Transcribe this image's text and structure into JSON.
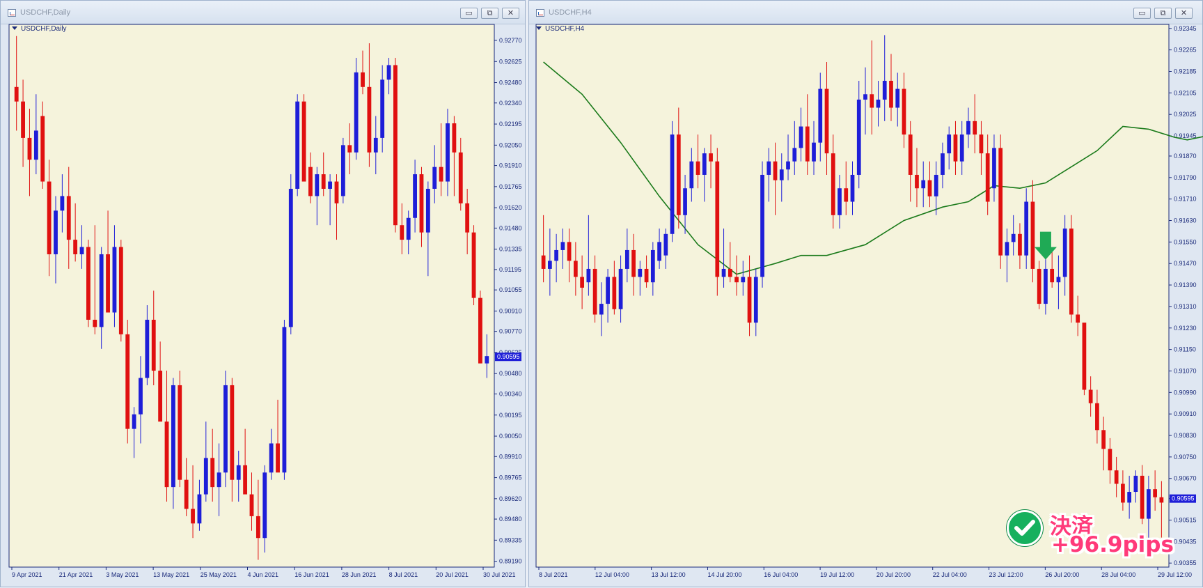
{
  "windows": [
    {
      "title": "USDCHF,Daily",
      "chart_label": "USDCHF,Daily"
    },
    {
      "title": "USDCHF,H4",
      "chart_label": "USDCHF,H4"
    }
  ],
  "window_buttons": {
    "minimize": "▭",
    "restore": "⧉",
    "close": "✕"
  },
  "colors": {
    "bg": "#f5f3dc",
    "bull": "#1e1ed8",
    "bear": "#e01010",
    "ma": "#1a7a1a",
    "axis": "#1a2a7a",
    "arrow": "#1faa55",
    "badge": "#16b05e",
    "settle_text": "#ff3a7a"
  },
  "annotation": {
    "line1": "決済",
    "line2": "+96.9pips"
  },
  "chart_data": [
    {
      "type": "candlestick",
      "symbol": "USDCHF",
      "timeframe": "Daily",
      "ylim": [
        0.8915,
        0.9288
      ],
      "yticks": [
        0.9277,
        0.92625,
        0.9248,
        0.9234,
        0.92195,
        0.9205,
        0.9191,
        0.91765,
        0.9162,
        0.9148,
        0.91335,
        0.91195,
        0.91055,
        0.9091,
        0.9077,
        0.90625,
        0.9048,
        0.9034,
        0.90195,
        0.9005,
        0.8991,
        0.89765,
        0.8962,
        0.8948,
        0.89335,
        0.8919
      ],
      "xticks": [
        "9 Apr 2021",
        "21 Apr 2021",
        "3 May 2021",
        "13 May 2021",
        "25 May 2021",
        "4 Jun 2021",
        "16 Jun 2021",
        "28 Jun 2021",
        "8 Jul 2021",
        "20 Jul 2021",
        "30 Jul 2021"
      ],
      "current_price": "0.90595",
      "ohlc": [
        [
          0.9245,
          0.928,
          0.9215,
          0.9235
        ],
        [
          0.9235,
          0.925,
          0.919,
          0.921
        ],
        [
          0.921,
          0.923,
          0.917,
          0.9195
        ],
        [
          0.9195,
          0.924,
          0.9185,
          0.9215
        ],
        [
          0.9225,
          0.9235,
          0.9175,
          0.918
        ],
        [
          0.918,
          0.9195,
          0.9115,
          0.913
        ],
        [
          0.913,
          0.917,
          0.911,
          0.916
        ],
        [
          0.916,
          0.9185,
          0.9145,
          0.917
        ],
        [
          0.917,
          0.919,
          0.912,
          0.914
        ],
        [
          0.914,
          0.9165,
          0.9125,
          0.913
        ],
        [
          0.913,
          0.915,
          0.912,
          0.9135
        ],
        [
          0.9135,
          0.914,
          0.908,
          0.9085
        ],
        [
          0.9085,
          0.915,
          0.9075,
          0.908
        ],
        [
          0.908,
          0.9135,
          0.9065,
          0.913
        ],
        [
          0.913,
          0.916,
          0.91,
          0.909
        ],
        [
          0.909,
          0.915,
          0.908,
          0.9135
        ],
        [
          0.9135,
          0.914,
          0.907,
          0.9075
        ],
        [
          0.9075,
          0.9085,
          0.9,
          0.901
        ],
        [
          0.901,
          0.9025,
          0.899,
          0.902
        ],
        [
          0.902,
          0.906,
          0.9,
          0.9045
        ],
        [
          0.9045,
          0.9095,
          0.904,
          0.9085
        ],
        [
          0.9085,
          0.9105,
          0.904,
          0.905
        ],
        [
          0.905,
          0.907,
          0.903,
          0.9015
        ],
        [
          0.9015,
          0.905,
          0.896,
          0.897
        ],
        [
          0.897,
          0.9045,
          0.8955,
          0.904
        ],
        [
          0.904,
          0.905,
          0.897,
          0.8975
        ],
        [
          0.8975,
          0.899,
          0.895,
          0.8955
        ],
        [
          0.8955,
          0.8985,
          0.8935,
          0.8945
        ],
        [
          0.8945,
          0.8975,
          0.894,
          0.8965
        ],
        [
          0.8965,
          0.9015,
          0.896,
          0.899
        ],
        [
          0.899,
          0.901,
          0.896,
          0.897
        ],
        [
          0.897,
          0.9,
          0.895,
          0.898
        ],
        [
          0.898,
          0.905,
          0.897,
          0.904
        ],
        [
          0.904,
          0.9045,
          0.896,
          0.8975
        ],
        [
          0.8975,
          0.8995,
          0.896,
          0.8985
        ],
        [
          0.8985,
          0.901,
          0.897,
          0.8965
        ],
        [
          0.8965,
          0.898,
          0.894,
          0.895
        ],
        [
          0.895,
          0.8975,
          0.892,
          0.8935
        ],
        [
          0.8935,
          0.8985,
          0.8925,
          0.898
        ],
        [
          0.898,
          0.901,
          0.8975,
          0.9
        ],
        [
          0.9,
          0.903,
          0.8985,
          0.898
        ],
        [
          0.898,
          0.9085,
          0.8975,
          0.908
        ],
        [
          0.908,
          0.9185,
          0.9075,
          0.9175
        ],
        [
          0.9175,
          0.924,
          0.917,
          0.9235
        ],
        [
          0.9235,
          0.924,
          0.9185,
          0.918
        ],
        [
          0.919,
          0.92,
          0.9165,
          0.917
        ],
        [
          0.917,
          0.919,
          0.915,
          0.9185
        ],
        [
          0.9185,
          0.92,
          0.917,
          0.9175
        ],
        [
          0.9175,
          0.9185,
          0.915,
          0.918
        ],
        [
          0.918,
          0.9185,
          0.914,
          0.9165
        ],
        [
          0.917,
          0.921,
          0.9165,
          0.9205
        ],
        [
          0.9205,
          0.922,
          0.9185,
          0.92
        ],
        [
          0.92,
          0.9265,
          0.9195,
          0.9255
        ],
        [
          0.9255,
          0.927,
          0.924,
          0.9245
        ],
        [
          0.9245,
          0.9275,
          0.919,
          0.92
        ],
        [
          0.92,
          0.9225,
          0.9185,
          0.921
        ],
        [
          0.921,
          0.926,
          0.92,
          0.925
        ],
        [
          0.925,
          0.9265,
          0.924,
          0.926
        ],
        [
          0.926,
          0.9265,
          0.9145,
          0.915
        ],
        [
          0.915,
          0.9165,
          0.913,
          0.914
        ],
        [
          0.914,
          0.916,
          0.913,
          0.9155
        ],
        [
          0.9155,
          0.9195,
          0.9145,
          0.9185
        ],
        [
          0.9185,
          0.919,
          0.9135,
          0.9145
        ],
        [
          0.9145,
          0.918,
          0.9115,
          0.9175
        ],
        [
          0.9175,
          0.9205,
          0.9165,
          0.919
        ],
        [
          0.919,
          0.922,
          0.917,
          0.918
        ],
        [
          0.918,
          0.923,
          0.917,
          0.922
        ],
        [
          0.922,
          0.9225,
          0.917,
          0.92
        ],
        [
          0.92,
          0.921,
          0.916,
          0.9165
        ],
        [
          0.9165,
          0.9175,
          0.913,
          0.9145
        ],
        [
          0.9145,
          0.915,
          0.9095,
          0.91
        ],
        [
          0.91,
          0.9105,
          0.9055,
          0.9055
        ],
        [
          0.9055,
          0.9075,
          0.9045,
          0.906
        ]
      ]
    },
    {
      "type": "candlestick",
      "symbol": "USDCHF",
      "timeframe": "H4",
      "ylim": [
        0.9034,
        0.9236
      ],
      "yticks": [
        0.92345,
        0.92265,
        0.92185,
        0.92105,
        0.92025,
        0.91945,
        0.9187,
        0.9179,
        0.9171,
        0.9163,
        0.9155,
        0.9147,
        0.9139,
        0.9131,
        0.9123,
        0.9115,
        0.9107,
        0.9099,
        0.9091,
        0.9083,
        0.9075,
        0.9067,
        0.90595,
        0.90515,
        0.90435,
        0.90355
      ],
      "xticks": [
        "8 Jul 2021",
        "12 Jul 04:00",
        "13 Jul 12:00",
        "14 Jul 20:00",
        "16 Jul 04:00",
        "19 Jul 12:00",
        "20 Jul 20:00",
        "22 Jul 04:00",
        "23 Jul 12:00",
        "26 Jul 20:00",
        "28 Jul 04:00",
        "29 Jul 12:00"
      ],
      "current_price": "0.90595",
      "signal": {
        "type": "sell-arrow",
        "candle_index": 78
      },
      "ma": [
        [
          0,
          0.9222
        ],
        [
          6,
          0.921
        ],
        [
          12,
          0.9192
        ],
        [
          18,
          0.9172
        ],
        [
          24,
          0.9154
        ],
        [
          30,
          0.9143
        ],
        [
          36,
          0.9147
        ],
        [
          40,
          0.915
        ],
        [
          44,
          0.915
        ],
        [
          50,
          0.9154
        ],
        [
          56,
          0.9163
        ],
        [
          62,
          0.9168
        ],
        [
          66,
          0.917
        ],
        [
          70,
          0.9176
        ],
        [
          74,
          0.9175
        ],
        [
          78,
          0.9177
        ],
        [
          82,
          0.9183
        ],
        [
          86,
          0.9189
        ],
        [
          90,
          0.9198
        ],
        [
          94,
          0.9197
        ],
        [
          98,
          0.9194
        ],
        [
          100,
          0.9193
        ],
        [
          104,
          0.9195
        ],
        [
          108,
          0.9197
        ],
        [
          112,
          0.9195
        ],
        [
          116,
          0.9192
        ],
        [
          120,
          0.9185
        ],
        [
          124,
          0.9175
        ],
        [
          128,
          0.9166
        ],
        [
          132,
          0.9155
        ],
        [
          135,
          0.9146
        ],
        [
          138,
          0.9134
        ],
        [
          141,
          0.912
        ],
        [
          144,
          0.9106
        ]
      ],
      "ohlc": [
        [
          0.915,
          0.9165,
          0.914,
          0.9145
        ],
        [
          0.9145,
          0.916,
          0.9135,
          0.9148
        ],
        [
          0.9148,
          0.9158,
          0.914,
          0.9152
        ],
        [
          0.9152,
          0.916,
          0.9145,
          0.9155
        ],
        [
          0.9155,
          0.916,
          0.914,
          0.9148
        ],
        [
          0.9148,
          0.9155,
          0.9135,
          0.9142
        ],
        [
          0.9142,
          0.915,
          0.913,
          0.9138
        ],
        [
          0.914,
          0.9165,
          0.9135,
          0.9145
        ],
        [
          0.9145,
          0.915,
          0.9125,
          0.9128
        ],
        [
          0.9128,
          0.914,
          0.912,
          0.9132
        ],
        [
          0.9132,
          0.9145,
          0.9125,
          0.9142
        ],
        [
          0.9142,
          0.9148,
          0.9128,
          0.913
        ],
        [
          0.913,
          0.915,
          0.9125,
          0.9145
        ],
        [
          0.9145,
          0.916,
          0.914,
          0.9152
        ],
        [
          0.9152,
          0.9158,
          0.9135,
          0.9142
        ],
        [
          0.9142,
          0.9148,
          0.9135,
          0.9145
        ],
        [
          0.9145,
          0.915,
          0.9138,
          0.914
        ],
        [
          0.914,
          0.9155,
          0.9135,
          0.9152
        ],
        [
          0.9148,
          0.916,
          0.9145,
          0.9155
        ],
        [
          0.915,
          0.916,
          0.9145,
          0.9158
        ],
        [
          0.9158,
          0.92,
          0.9155,
          0.9195
        ],
        [
          0.9195,
          0.9205,
          0.916,
          0.9165
        ],
        [
          0.9165,
          0.918,
          0.9158,
          0.9175
        ],
        [
          0.9175,
          0.919,
          0.917,
          0.9185
        ],
        [
          0.9185,
          0.9195,
          0.9175,
          0.918
        ],
        [
          0.918,
          0.919,
          0.917,
          0.9188
        ],
        [
          0.9188,
          0.9195,
          0.9175,
          0.9185
        ],
        [
          0.9185,
          0.919,
          0.9135,
          0.9142
        ],
        [
          0.9142,
          0.916,
          0.9138,
          0.9145
        ],
        [
          0.9145,
          0.9155,
          0.914,
          0.9142
        ],
        [
          0.9142,
          0.915,
          0.9135,
          0.914
        ],
        [
          0.914,
          0.9148,
          0.9135,
          0.9142
        ],
        [
          0.9142,
          0.915,
          0.912,
          0.9125
        ],
        [
          0.9125,
          0.9145,
          0.912,
          0.9142
        ],
        [
          0.9142,
          0.9185,
          0.9138,
          0.918
        ],
        [
          0.918,
          0.919,
          0.917,
          0.9185
        ],
        [
          0.9185,
          0.9192,
          0.9165,
          0.9178
        ],
        [
          0.9178,
          0.9188,
          0.917,
          0.9182
        ],
        [
          0.9182,
          0.9195,
          0.9178,
          0.9185
        ],
        [
          0.9185,
          0.92,
          0.918,
          0.919
        ],
        [
          0.919,
          0.9205,
          0.9185,
          0.9198
        ],
        [
          0.9198,
          0.921,
          0.918,
          0.9185
        ],
        [
          0.9185,
          0.92,
          0.918,
          0.9192
        ],
        [
          0.9192,
          0.9218,
          0.9185,
          0.9212
        ],
        [
          0.9212,
          0.9222,
          0.918,
          0.9188
        ],
        [
          0.9188,
          0.9195,
          0.916,
          0.9165
        ],
        [
          0.9165,
          0.918,
          0.916,
          0.9175
        ],
        [
          0.9175,
          0.9185,
          0.9165,
          0.917
        ],
        [
          0.917,
          0.9185,
          0.9165,
          0.918
        ],
        [
          0.918,
          0.9215,
          0.9175,
          0.9208
        ],
        [
          0.9208,
          0.922,
          0.9195,
          0.921
        ],
        [
          0.921,
          0.923,
          0.9195,
          0.9205
        ],
        [
          0.9205,
          0.9215,
          0.9198,
          0.9208
        ],
        [
          0.9208,
          0.9232,
          0.92,
          0.9215
        ],
        [
          0.9215,
          0.9225,
          0.92,
          0.9205
        ],
        [
          0.9205,
          0.9218,
          0.9198,
          0.9212
        ],
        [
          0.9212,
          0.9218,
          0.919,
          0.9195
        ],
        [
          0.9195,
          0.92,
          0.917,
          0.918
        ],
        [
          0.918,
          0.919,
          0.9168,
          0.9175
        ],
        [
          0.9175,
          0.9185,
          0.9168,
          0.9178
        ],
        [
          0.9178,
          0.9185,
          0.9168,
          0.9172
        ],
        [
          0.9172,
          0.9185,
          0.9165,
          0.918
        ],
        [
          0.918,
          0.9192,
          0.9175,
          0.9188
        ],
        [
          0.9188,
          0.9198,
          0.9182,
          0.9195
        ],
        [
          0.9195,
          0.92,
          0.918,
          0.9185
        ],
        [
          0.9185,
          0.92,
          0.918,
          0.9195
        ],
        [
          0.9195,
          0.9205,
          0.919,
          0.92
        ],
        [
          0.92,
          0.921,
          0.9188,
          0.9195
        ],
        [
          0.9195,
          0.92,
          0.918,
          0.9188
        ],
        [
          0.9188,
          0.9195,
          0.9165,
          0.917
        ],
        [
          0.9175,
          0.9195,
          0.917,
          0.919
        ],
        [
          0.919,
          0.9195,
          0.9145,
          0.915
        ],
        [
          0.915,
          0.916,
          0.914,
          0.9155
        ],
        [
          0.9155,
          0.9165,
          0.915,
          0.9158
        ],
        [
          0.9158,
          0.9162,
          0.9145,
          0.915
        ],
        [
          0.915,
          0.9175,
          0.9145,
          0.917
        ],
        [
          0.917,
          0.9178,
          0.914,
          0.9145
        ],
        [
          0.9145,
          0.9148,
          0.913,
          0.9132
        ],
        [
          0.9132,
          0.915,
          0.9128,
          0.9145
        ],
        [
          0.9145,
          0.9152,
          0.9138,
          0.914
        ],
        [
          0.914,
          0.915,
          0.913,
          0.9142
        ],
        [
          0.9142,
          0.9165,
          0.9135,
          0.916
        ],
        [
          0.916,
          0.9165,
          0.9125,
          0.9128
        ],
        [
          0.9128,
          0.9135,
          0.912,
          0.9125
        ],
        [
          0.9125,
          0.91,
          0.9098,
          0.91
        ],
        [
          0.91,
          0.9105,
          0.909,
          0.9095
        ],
        [
          0.9095,
          0.91,
          0.908,
          0.9085
        ],
        [
          0.9085,
          0.909,
          0.907,
          0.9078
        ],
        [
          0.9078,
          0.9082,
          0.9065,
          0.907
        ],
        [
          0.907,
          0.9075,
          0.906,
          0.9065
        ],
        [
          0.9065,
          0.907,
          0.9055,
          0.9058
        ],
        [
          0.9058,
          0.9068,
          0.9052,
          0.9062
        ],
        [
          0.9062,
          0.907,
          0.9058,
          0.9068
        ],
        [
          0.9068,
          0.9072,
          0.905,
          0.9052
        ],
        [
          0.9052,
          0.9068,
          0.9042,
          0.9063
        ],
        [
          0.9063,
          0.907,
          0.9055,
          0.906
        ],
        [
          0.906,
          0.9066,
          0.9045,
          0.9058
        ]
      ]
    }
  ]
}
